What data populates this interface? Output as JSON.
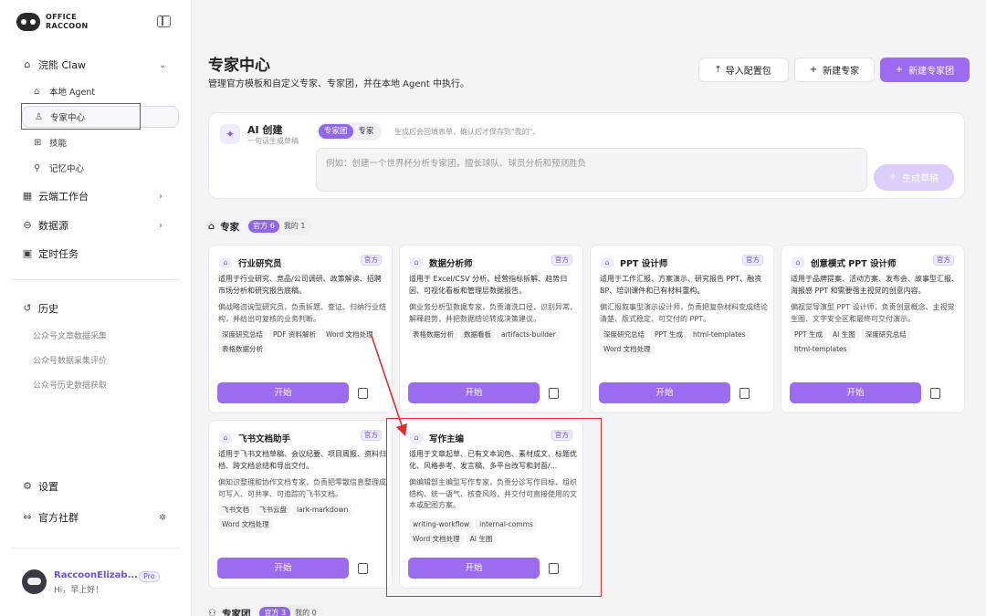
{
  "brand": {
    "line1": "OFFICE",
    "line2": "RACCOON"
  },
  "sidebar": {
    "claw": {
      "label": "浣熊 Claw",
      "icon": "robot-icon"
    },
    "subitems": [
      {
        "label": "本地 Agent",
        "icon": "robot-icon"
      },
      {
        "label": "专家中心",
        "icon": "user-icon",
        "active": true
      },
      {
        "label": "技能",
        "icon": "grid-plus-icon"
      },
      {
        "label": "记忆中心",
        "icon": "bulb-icon"
      }
    ],
    "cloud": {
      "label": "云端工作台"
    },
    "datasource": {
      "label": "数据源"
    },
    "scheduled": {
      "label": "定时任务"
    },
    "history": {
      "label": "历史",
      "items": [
        "公众号文章数据采集",
        "公众号数据采集评价",
        "公众号历史数据获取"
      ]
    },
    "settings": {
      "label": "设置"
    },
    "community": {
      "label": "官方社群"
    },
    "user": {
      "name": "RaccoonElizab...",
      "greeting": "Hi，早上好！",
      "pro": "Pro"
    }
  },
  "header": {
    "title": "专家中心",
    "subtitle": "管理官方模板和自定义专家、专家团，并在本地 Agent 中执行。",
    "import_btn": "导入配置包",
    "new_expert_btn": "新建专家",
    "new_team_btn": "新建专家团"
  },
  "ai_panel": {
    "title": "AI 创建",
    "subtitle": "一句话生成草稿",
    "seg_team": "专家团",
    "seg_expert": "专家",
    "hint": "生成后会回填表单，确认后才保存到\"我的\"。",
    "placeholder": "例如：创建一个世界杯分析专家团，擅长球队、球员分析和预测胜负",
    "generate_btn": "生成草稿"
  },
  "experts_section": {
    "label": "专家",
    "official": "官方 6",
    "mine": "我的 1"
  },
  "teams_section": {
    "label": "专家团",
    "official": "官方 3",
    "mine": "我的 0"
  },
  "cards": [
    {
      "title": "行业研究员",
      "badge": "官方",
      "desc1": "适用于行业研究、竞品/公司调研、政策解读、招聘市场分析和研究报告底稿。",
      "desc2": "偏战略咨询型研究员，负责拆题、查证、归纳行业结构，并给出可复核的业务判断。",
      "tags": [
        "深度研究总结",
        "PDF 资料解析",
        "Word 文档处理",
        "表格数据分析"
      ],
      "start": "开始"
    },
    {
      "title": "数据分析师",
      "badge": "官方",
      "desc1": "适用于 Excel/CSV 分析、经营指标拆解、趋势归因、可视化看板和管理层数据报告。",
      "desc2": "偏业务分析型数据专家，负责清洗口径、识别异常、解释趋势，并把数据结论转成决策建议。",
      "tags": [
        "表格数据分析",
        "数据看板",
        "artifacts-builder"
      ],
      "start": "开始"
    },
    {
      "title": "PPT 设计师",
      "badge": "官方",
      "desc1": "适用于工作汇报、方案演示、研究报告 PPT、融资 BP、培训课件和已有材料重构。",
      "desc2": "偏汇报叙事型演示设计师，负责把复杂材料变成结论清楚、版式稳定、可交付的 PPT。",
      "tags": [
        "深度研究总结",
        "PPT 生成",
        "html-templates",
        "Word 文档处理"
      ],
      "start": "开始"
    },
    {
      "title": "创意模式 PPT 设计师",
      "badge": "官方",
      "desc1": "适用于品牌提案、活动方案、发布会、故事型汇报、海报感 PPT 和需要强主视觉的创意内容。",
      "desc2": "偏视觉导演型 PPT 设计师，负责创意概念、主视觉生图、文字安全区和最终可交付演示。",
      "tags": [
        "PPT 生成",
        "AI 生图",
        "深度研究总结",
        "html-templates"
      ],
      "start": "开始"
    },
    {
      "title": "飞书文档助手",
      "badge": "官方",
      "desc1": "适用于飞书文档草稿、会议纪要、项目周报、资料归档、跨文档总结和导出交付。",
      "desc2": "偏知识整理和协作文档专家，负责把零散信息整理成可写入、可共享、可追踪的飞书文档。",
      "tags": [
        "飞书文档",
        "飞书云盘",
        "lark-markdown",
        "Word 文档处理"
      ],
      "start": "开始"
    },
    {
      "title": "写作主编",
      "badge": "官方",
      "desc1": "适用于文章起草、已有文本润色、素材成文、标题优化、风格参考、发言稿、多平台改写和封面/...",
      "desc2": "偏编辑部主编型写作专家，负责分诊写作目标、组织结构、统一语气、核查风险，并交付可直接使用的文本或配图方案。",
      "tags": [
        "writing-workflow",
        "internal-comms",
        "Word 文档处理",
        "AI 生图"
      ],
      "start": "开始"
    }
  ]
}
